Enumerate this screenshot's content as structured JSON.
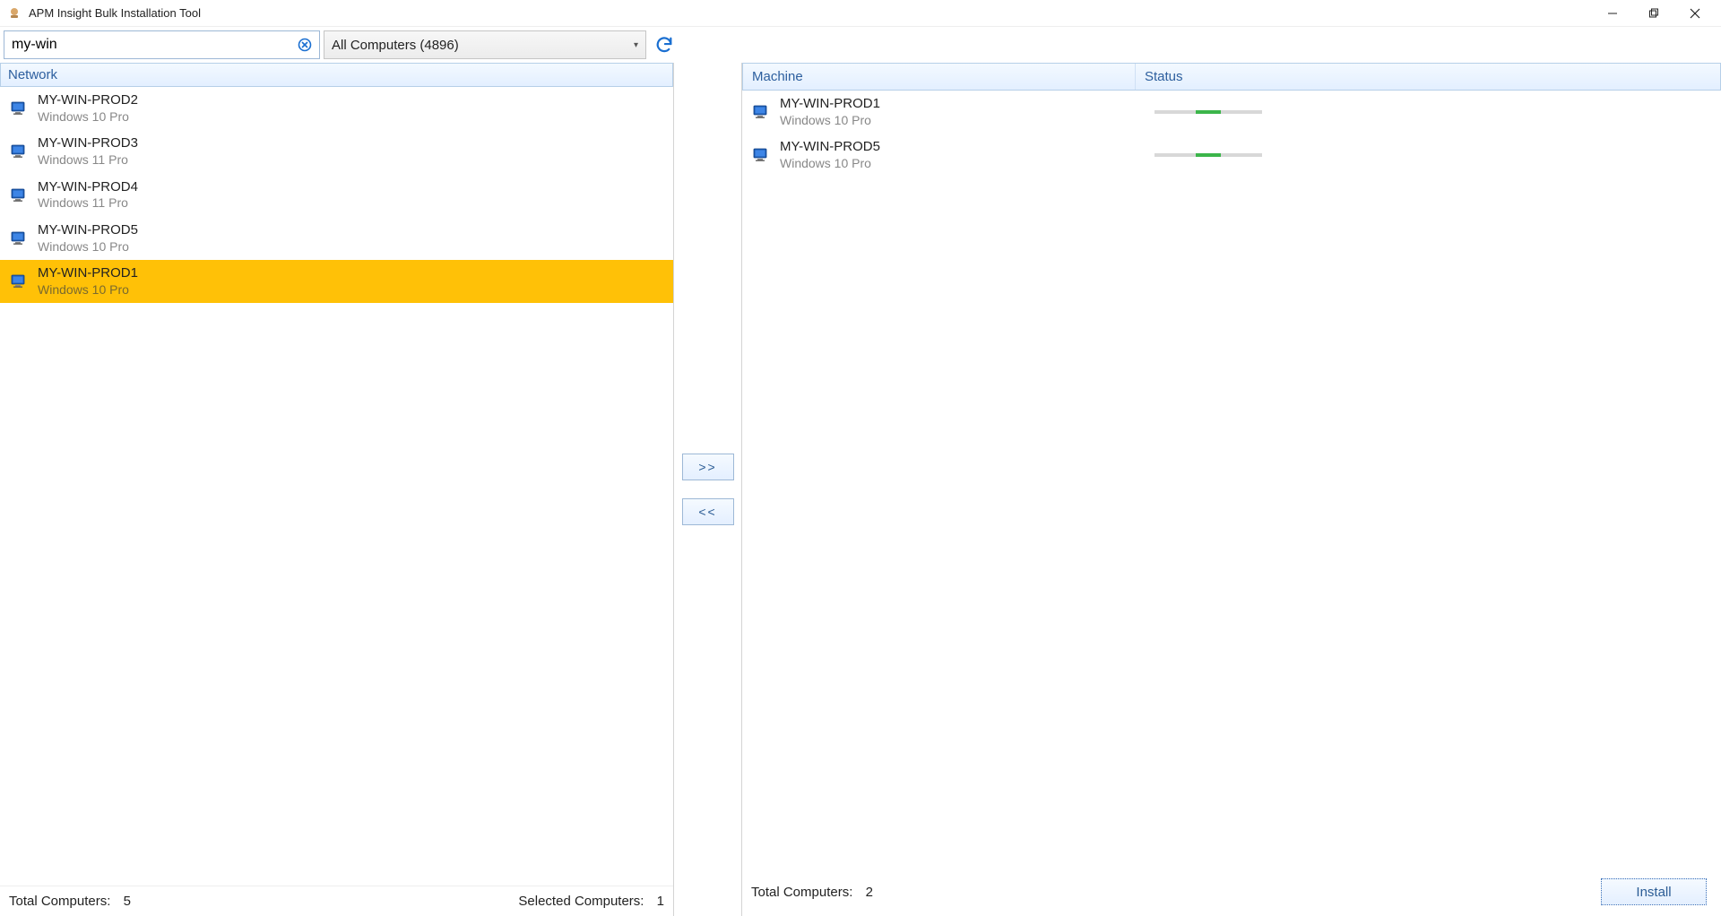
{
  "window": {
    "title": "APM Insight Bulk Installation Tool"
  },
  "toolbar": {
    "search_value": "my-win",
    "filter_label": "All Computers (4896)"
  },
  "left": {
    "group_header": "Network",
    "machines": [
      {
        "name": "MY-WIN-PROD2",
        "os": "Windows 10 Pro",
        "selected": false
      },
      {
        "name": "MY-WIN-PROD3",
        "os": "Windows 11 Pro",
        "selected": false
      },
      {
        "name": "MY-WIN-PROD4",
        "os": "Windows 11 Pro",
        "selected": false
      },
      {
        "name": "MY-WIN-PROD5",
        "os": "Windows 10 Pro",
        "selected": false
      },
      {
        "name": "MY-WIN-PROD1",
        "os": "Windows 10 Pro",
        "selected": true
      }
    ],
    "footer": {
      "total_label": "Total Computers:",
      "total_value": "5",
      "selected_label": "Selected Computers:",
      "selected_value": "1"
    }
  },
  "middle": {
    "add_label": ">>",
    "remove_label": "<<"
  },
  "right": {
    "headers": {
      "machine": "Machine",
      "status": "Status"
    },
    "targets": [
      {
        "name": "MY-WIN-PROD1",
        "os": "Windows 10 Pro"
      },
      {
        "name": "MY-WIN-PROD5",
        "os": "Windows 10 Pro"
      }
    ],
    "footer": {
      "total_label": "Total Computers:",
      "total_value": "2",
      "install_label": "Install"
    }
  }
}
